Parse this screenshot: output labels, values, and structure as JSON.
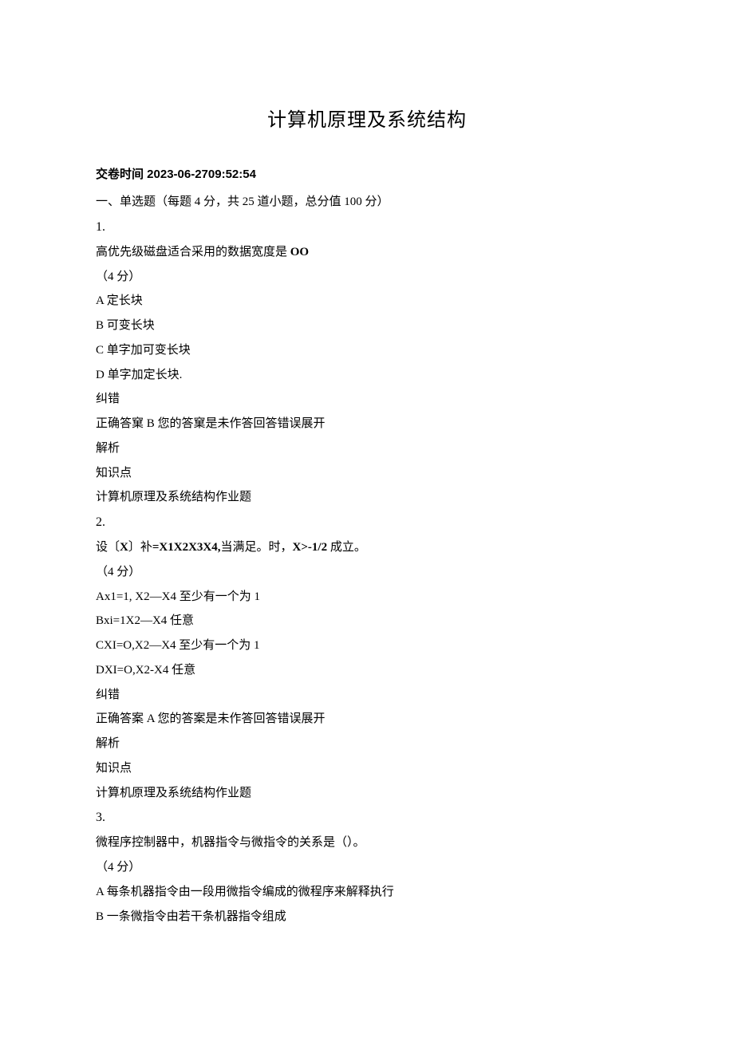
{
  "title": "计算机原理及系统结构",
  "meta": "交卷时间 2023-06-2709:52:54",
  "section_header": "一、单选题（每题 4 分，共 25 道小题，总分值 100 分）",
  "common": {
    "feedback_link": "纠错",
    "analysis": "解析",
    "knowledge": "知识点",
    "kp_value": "计算机原理及系统结构作业题"
  },
  "q1": {
    "num": "1.",
    "stem_prefix": "高优先级磁盘适合采用的数据宽度是 ",
    "stem_bold": "OO",
    "points": "（4 分）",
    "optA": "A 定长块",
    "optB": "B 可变长块",
    "optC": "C 单字加可变长块",
    "optD": "D 单字加定长块.",
    "answer": "正确答窠 B 您的答窠是未作答回答错误展开"
  },
  "q2": {
    "num": "2.",
    "stem_p1": "设〔",
    "stem_b1": "X",
    "stem_p2": "〕补",
    "stem_b2": "=X1X2X3X4,",
    "stem_p3": "当满足。时，",
    "stem_b3": "X>-1/2",
    "stem_p4": " 成立。",
    "points": "（4 分）",
    "optA": "Ax1=1, X2—X4 至少有一个为 1",
    "optB": "Bxi=1X2—X4 任意",
    "optC": "CXI=O,X2—X4 至少有一个为 1",
    "optD": "DXI=O,X2-X4 任意",
    "answer": "正确答案 A 您的答案是未作答回答错误展开"
  },
  "q3": {
    "num": "3.",
    "stem": "微程序控制器中，机器指令与微指令的关系是（）。",
    "points": "（4 分）",
    "optA": "A 每条机器指令由一段用微指令编成的微程序来解释执行",
    "optB": "B 一条微指令由若干条机器指令组成"
  }
}
